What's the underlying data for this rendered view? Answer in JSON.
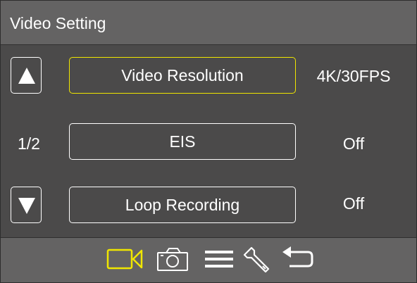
{
  "header": {
    "title": "Video Setting"
  },
  "page_indicator": "1/2",
  "menu": {
    "items": [
      {
        "label": "Video Resolution",
        "value": "4K/30FPS",
        "selected": true
      },
      {
        "label": "EIS",
        "value": "Off",
        "selected": false
      },
      {
        "label": "Loop Recording",
        "value": "Off",
        "selected": false
      }
    ]
  },
  "footer": {
    "tabs": [
      {
        "icon": "video-camera-icon",
        "active": true
      },
      {
        "icon": "camera-icon",
        "active": false
      },
      {
        "icon": "menu-icon",
        "active": false
      },
      {
        "icon": "wrench-icon",
        "active": false
      },
      {
        "icon": "return-icon",
        "active": false
      }
    ]
  },
  "colors": {
    "background": "#4b4a4a",
    "header_bar": "#646363",
    "selected_accent": "#f0e600",
    "text": "#ffffff"
  }
}
